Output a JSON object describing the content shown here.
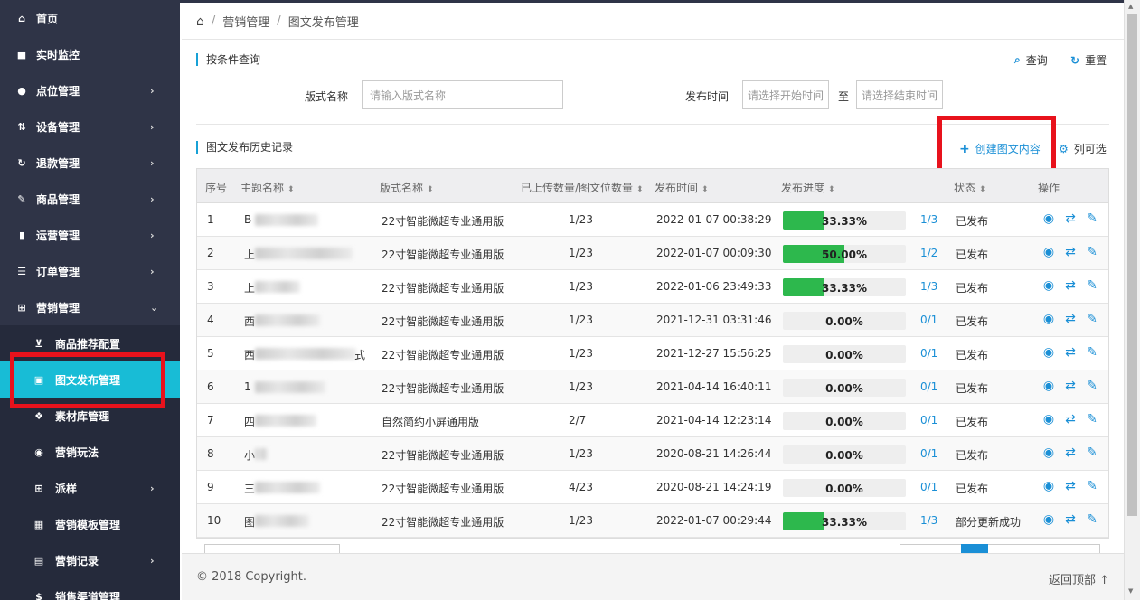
{
  "sidebar": {
    "items": [
      {
        "label": "首页",
        "icon": "home-icon",
        "glyph": "⌂",
        "arrow": ""
      },
      {
        "label": "实时监控",
        "icon": "video-icon",
        "glyph": "■",
        "arrow": ""
      },
      {
        "label": "点位管理",
        "icon": "map-marker-icon",
        "glyph": "●",
        "arrow": "›"
      },
      {
        "label": "设备管理",
        "icon": "sort-icon",
        "glyph": "⇅",
        "arrow": "›"
      },
      {
        "label": "退款管理",
        "icon": "refresh-icon",
        "glyph": "↻",
        "arrow": "›"
      },
      {
        "label": "商品管理",
        "icon": "edit-icon",
        "glyph": "✎",
        "arrow": "›"
      },
      {
        "label": "运营管理",
        "icon": "bookmark-icon",
        "glyph": "▮",
        "arrow": "›"
      },
      {
        "label": "订单管理",
        "icon": "list-icon",
        "glyph": "☰",
        "arrow": "›"
      },
      {
        "label": "营销管理",
        "icon": "gift-icon",
        "glyph": "⊞",
        "arrow": "⌄"
      }
    ],
    "subitems": [
      {
        "label": "商品推荐配置",
        "icon": "cart-icon",
        "glyph": "⊻",
        "arrow": ""
      },
      {
        "label": "图文发布管理",
        "icon": "image-icon",
        "glyph": "▣",
        "arrow": ""
      },
      {
        "label": "素材库管理",
        "icon": "cubes-icon",
        "glyph": "❖",
        "arrow": ""
      },
      {
        "label": "营销玩法",
        "icon": "gamepad-icon",
        "glyph": "◉",
        "arrow": ""
      },
      {
        "label": "派样",
        "icon": "gift-small-icon",
        "glyph": "⊞",
        "arrow": "›"
      },
      {
        "label": "营销模板管理",
        "icon": "table-icon",
        "glyph": "▦",
        "arrow": ""
      },
      {
        "label": "营销记录",
        "icon": "book-icon",
        "glyph": "▤",
        "arrow": "›"
      },
      {
        "label": "销售渠道管理",
        "icon": "dollar-icon",
        "glyph": "$",
        "arrow": ""
      }
    ]
  },
  "breadcrumb": {
    "home_glyph": "⌂",
    "sep": "/",
    "level1": "营销管理",
    "level2": "图文发布管理"
  },
  "query": {
    "title": "按条件查询",
    "search_label": "查询",
    "reset_label": "重置",
    "search_glyph": "⌕",
    "reset_glyph": "↻",
    "layout_label": "版式名称",
    "layout_placeholder": "请输入版式名称",
    "time_label": "发布时间",
    "start_placeholder": "请选择开始时间",
    "to_label": "至",
    "end_placeholder": "请选择结束时间"
  },
  "history": {
    "title": "图文发布历史记录",
    "create_label": "创建图文内容",
    "create_glyph": "+",
    "columns_label": "列可选",
    "columns_glyph": "⚙"
  },
  "table": {
    "headers": [
      "序号",
      "主题名称",
      "版式名称",
      "已上传数量/图文位数量",
      "发布时间",
      "发布进度",
      "状态",
      "操作"
    ],
    "rows": [
      {
        "no": "1",
        "name": "B",
        "layout": "22寸智能微超专业通用版",
        "upload": "1/23",
        "time": "2022-01-07 00:38:29",
        "progress": 33.33,
        "progress_text": "33.33%",
        "frac": "1/3",
        "status": "已发布"
      },
      {
        "no": "2",
        "name": "上",
        "layout": "22寸智能微超专业通用版",
        "upload": "1/23",
        "time": "2022-01-07 00:09:30",
        "progress": 50.0,
        "progress_text": "50.00%",
        "frac": "1/2",
        "status": "已发布"
      },
      {
        "no": "3",
        "name": "上",
        "layout": "22寸智能微超专业通用版",
        "upload": "1/23",
        "time": "2022-01-06 23:49:33",
        "progress": 33.33,
        "progress_text": "33.33%",
        "frac": "1/3",
        "status": "已发布"
      },
      {
        "no": "4",
        "name": "西",
        "layout": "22寸智能微超专业通用版",
        "upload": "1/23",
        "time": "2021-12-31 03:31:46",
        "progress": 0,
        "progress_text": "0.00%",
        "frac": "0/1",
        "status": "已发布"
      },
      {
        "no": "5",
        "name": "西",
        "name_tail": "式",
        "layout": "22寸智能微超专业通用版",
        "upload": "1/23",
        "time": "2021-12-27 15:56:25",
        "progress": 0,
        "progress_text": "0.00%",
        "frac": "0/1",
        "status": "已发布"
      },
      {
        "no": "6",
        "name": "1",
        "layout": "22寸智能微超专业通用版",
        "upload": "1/23",
        "time": "2021-04-14 16:40:11",
        "progress": 0,
        "progress_text": "0.00%",
        "frac": "0/1",
        "status": "已发布"
      },
      {
        "no": "7",
        "name": "四",
        "layout": "自然简约小屏通用版",
        "upload": "2/7",
        "time": "2021-04-14 12:23:14",
        "progress": 0,
        "progress_text": "0.00%",
        "frac": "0/1",
        "status": "已发布"
      },
      {
        "no": "8",
        "name": "小",
        "layout": "22寸智能微超专业通用版",
        "upload": "1/23",
        "time": "2020-08-21 14:26:44",
        "progress": 0,
        "progress_text": "0.00%",
        "frac": "0/1",
        "status": "已发布"
      },
      {
        "no": "9",
        "name": "三",
        "layout": "22寸智能微超专业通用版",
        "upload": "4/23",
        "time": "2020-08-21 14:24:19",
        "progress": 0,
        "progress_text": "0.00%",
        "frac": "0/1",
        "status": "已发布"
      },
      {
        "no": "10",
        "name": "图",
        "layout": "22寸智能微超专业通用版",
        "upload": "1/23",
        "time": "2022-01-07 00:29:44",
        "progress": 33.33,
        "progress_text": "33.33%",
        "frac": "1/3",
        "status": "部分更新成功"
      }
    ],
    "op_glyphs": {
      "view": "◉",
      "republish": "⇄",
      "edit": "✎"
    }
  },
  "footer": {
    "copyright": "© 2018 Copyright.",
    "back_top": "返回顶部 ↑"
  },
  "colors": {
    "sidebar": "#2f3447",
    "active": "#18bcd6",
    "accent": "#1a8fd6",
    "progress": "#2db84d",
    "highlight": "#e8121c"
  }
}
